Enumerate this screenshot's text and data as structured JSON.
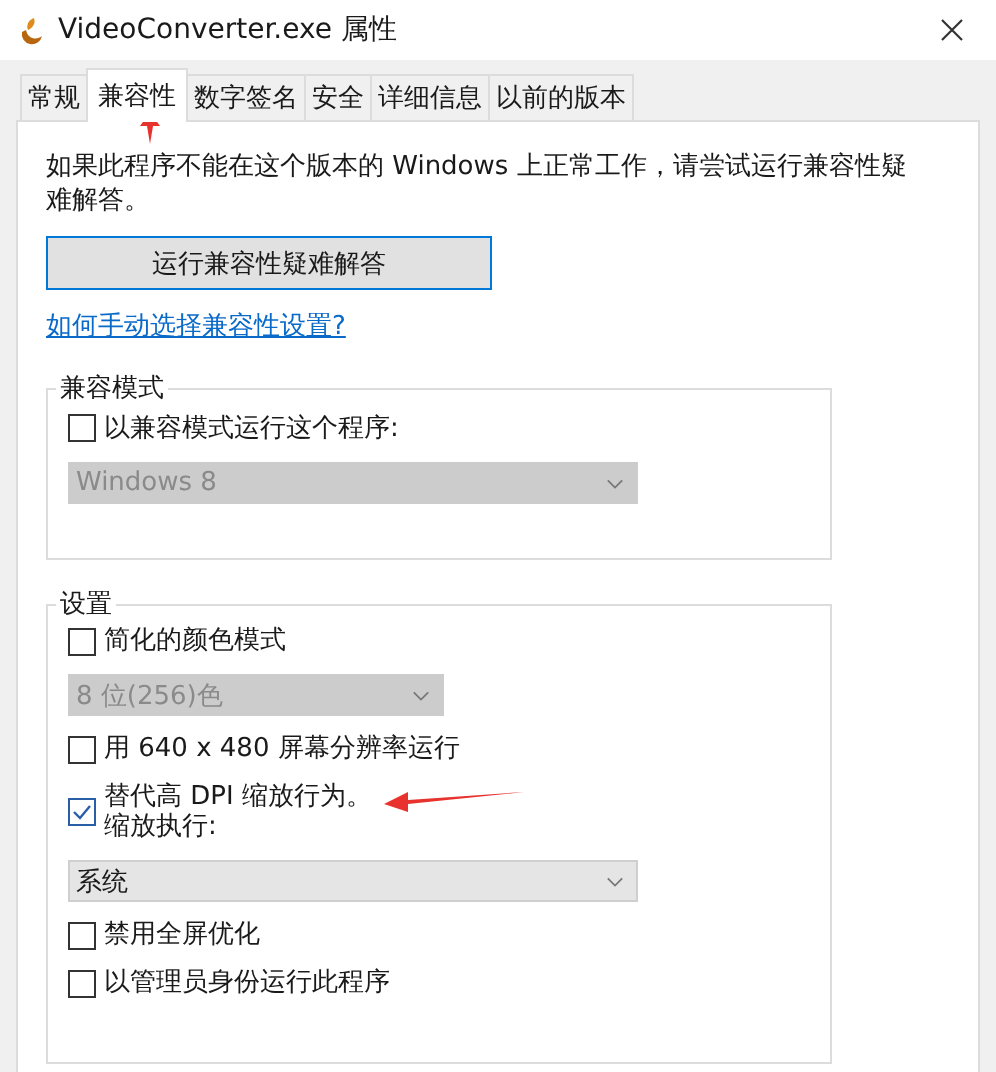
{
  "window": {
    "title": "VideoConverter.exe 属性"
  },
  "tabs": [
    {
      "label": "常规",
      "selected": false
    },
    {
      "label": "兼容性",
      "selected": true
    },
    {
      "label": "数字签名",
      "selected": false
    },
    {
      "label": "安全",
      "selected": false
    },
    {
      "label": "详细信息",
      "selected": false
    },
    {
      "label": "以前的版本",
      "selected": false
    }
  ],
  "description": "如果此程序不能在这个版本的 Windows 上正常工作，请尝试运行兼容性疑难解答。",
  "troubleshoot_button": "运行兼容性疑难解答",
  "help_link": "如何手动选择兼容性设置?",
  "compat_mode": {
    "title": "兼容模式",
    "checkbox": {
      "label": "以兼容模式运行这个程序:",
      "checked": false
    },
    "dropdown": {
      "value": "Windows 8",
      "disabled": true
    }
  },
  "settings": {
    "title": "设置",
    "items": [
      {
        "kind": "checkbox",
        "label": "简化的颜色模式",
        "checked": false
      },
      {
        "kind": "dropdown",
        "value": "8 位(256)色",
        "disabled": true
      },
      {
        "kind": "checkbox",
        "label": "用 640 x 480 屏幕分辨率运行",
        "checked": false
      },
      {
        "kind": "checkbox",
        "label": "替代高 DPI 缩放行为。",
        "sublabel": "缩放执行:",
        "checked": true
      },
      {
        "kind": "dropdown",
        "value": "系统",
        "disabled": false
      },
      {
        "kind": "checkbox",
        "label": "禁用全屏优化",
        "checked": false
      },
      {
        "kind": "checkbox",
        "label": "以管理员身份运行此程序",
        "checked": false
      }
    ]
  }
}
